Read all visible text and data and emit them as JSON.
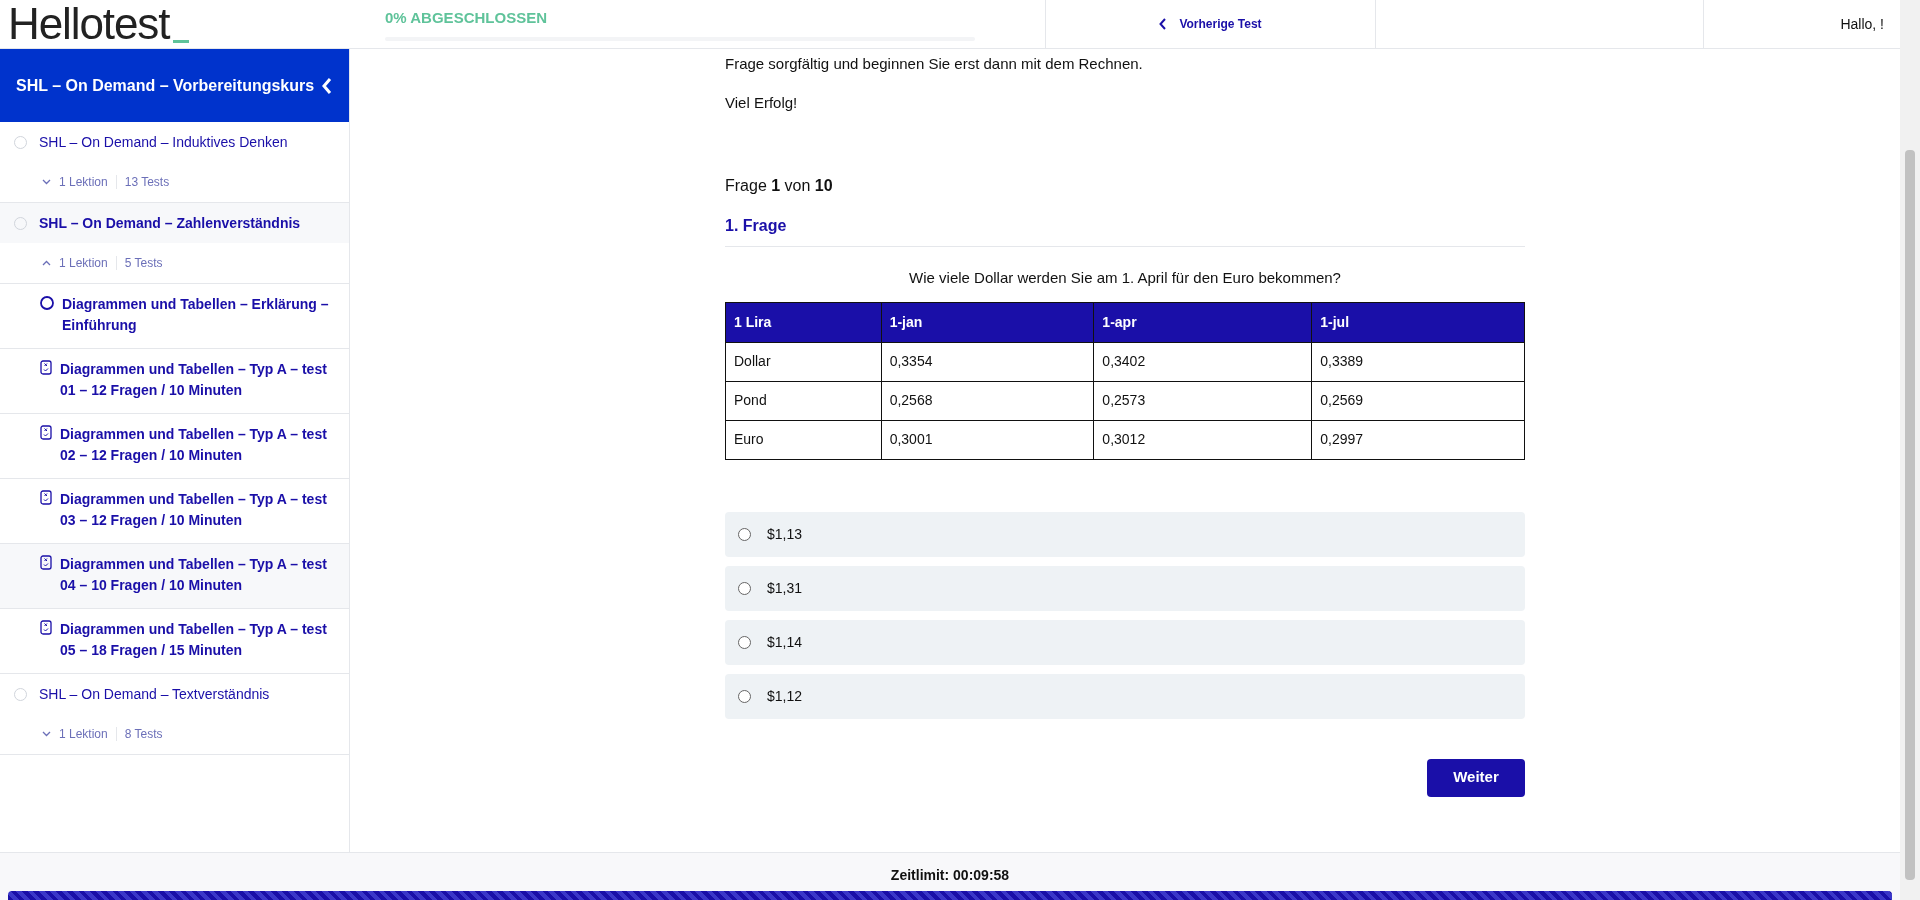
{
  "header": {
    "logo": "Hellotest",
    "progress_label": "0% ABGESCHLOSSEN",
    "progress": {
      "level": 0
    },
    "prev_button": "Vorherige Test",
    "greeting": "Hallo, !"
  },
  "sidebar": {
    "title": "SHL – On Demand – Vorbereitungskurs",
    "sections": [
      {
        "title": "SHL – On Demand – Induktives Denken",
        "selected": false,
        "expanded": false,
        "lessons": "1 Lektion",
        "tests": "13 Tests"
      },
      {
        "title": "SHL – On Demand – Zahlenverständnis",
        "selected": true,
        "expanded": true,
        "lessons": "1 Lektion",
        "tests": "5 Tests",
        "children": [
          {
            "kind": "lesson",
            "title": "Diagrammen und Tabellen – Erklärung – Einführung",
            "selected": false
          },
          {
            "kind": "quiz",
            "title": "Diagrammen und Tabellen – Typ A – test 01 – 12 Fragen / 10 Minuten",
            "selected": false
          },
          {
            "kind": "quiz",
            "title": "Diagrammen und Tabellen – Typ A – test 02 – 12 Fragen / 10 Minuten",
            "selected": false
          },
          {
            "kind": "quiz",
            "title": "Diagrammen und Tabellen – Typ A – test 03 – 12 Fragen / 10 Minuten",
            "selected": false
          },
          {
            "kind": "quiz",
            "title": "Diagrammen und Tabellen – Typ A – test 04 – 10 Fragen / 10 Minuten",
            "selected": true
          },
          {
            "kind": "quiz",
            "title": "Diagrammen und Tabellen – Typ A – test 05 – 18 Fragen / 15 Minuten",
            "selected": false
          }
        ]
      },
      {
        "title": "SHL – On Demand – Textverständnis",
        "selected": false,
        "expanded": false,
        "lessons": "1 Lektion",
        "tests": "8 Tests"
      }
    ]
  },
  "main": {
    "intro": [
      "Frage sorgfältig und beginnen Sie erst dann mit dem Rechnen.",
      "Viel Erfolg!"
    ],
    "counter": "Frage **1** von **10**",
    "question_title": "1. Frage",
    "question": "Wie viele Dollar werden Sie am 1. April für den Euro bekommen?",
    "table": {
      "columns": [
        "1 Lira",
        "1-jan",
        "1-apr",
        "1-jul"
      ],
      "rows": [
        [
          "Dollar",
          "0,3354",
          "0,3402",
          "0,3389"
        ],
        [
          "Pond",
          "0,2568",
          "0,2573",
          "0,2569"
        ],
        [
          "Euro",
          "0,3001",
          "0,3012",
          "0,2997"
        ]
      ]
    },
    "options": [
      {
        "label": "$1,13",
        "selected": false
      },
      {
        "label": "$1,31",
        "selected": false
      },
      {
        "label": "$1,14",
        "selected": false
      },
      {
        "label": "$1,12",
        "selected": false
      }
    ],
    "next_button": "Weiter"
  },
  "footer": {
    "timer": "Zeitlimit: 00:09:58",
    "time_bar": {
      "level": 1
    }
  }
}
